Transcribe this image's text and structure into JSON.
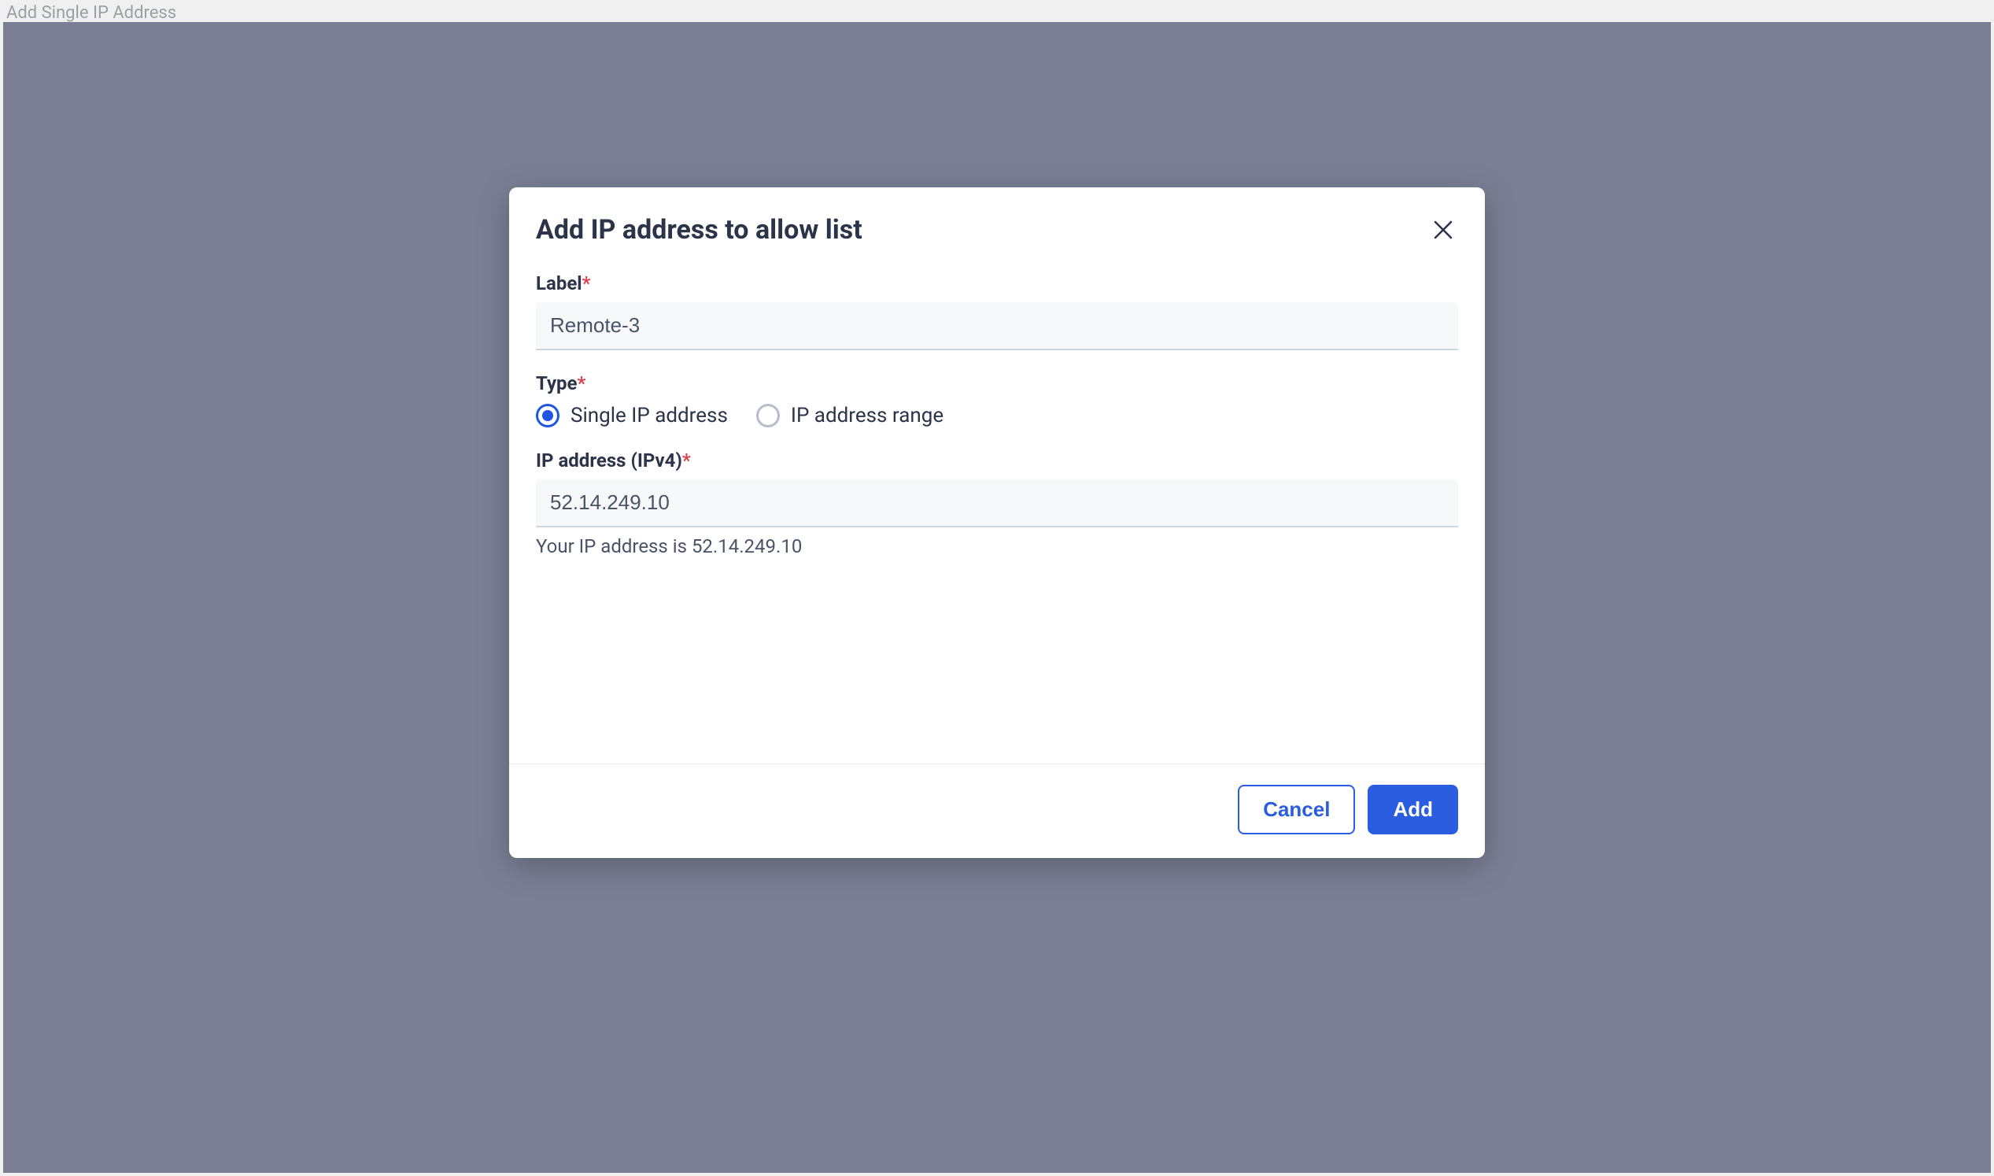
{
  "page": {
    "header_text": "Add Single IP Address"
  },
  "modal": {
    "title": "Add IP address to allow list",
    "label_field": {
      "label": "Label",
      "value": "Remote-3"
    },
    "type_field": {
      "label": "Type",
      "options": {
        "single": "Single IP address",
        "range": "IP address range"
      }
    },
    "ip_field": {
      "label": "IP address (IPv4)",
      "value": "52.14.249.10",
      "helper": "Your IP address is 52.14.249.10"
    },
    "footer": {
      "cancel": "Cancel",
      "add": "Add"
    }
  }
}
